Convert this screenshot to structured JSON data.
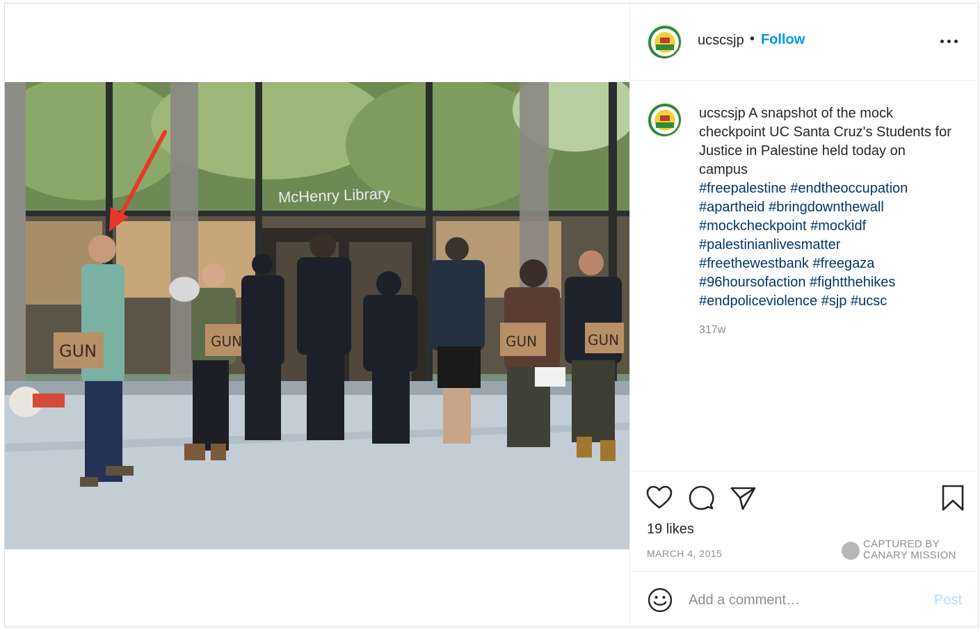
{
  "post": {
    "username": "ucscsjp",
    "separator": "•",
    "follow_label": "Follow",
    "more_icon": "more-horizontal-icon",
    "photo": {
      "building_sign": "McHenry Library",
      "sign_text": "GUN",
      "arrow_color": "#e8372b"
    },
    "caption": {
      "username": "ucscsjp",
      "text": "A snapshot of the mock checkpoint UC Santa Cruz's Students for Justice in Palestine held today on campus",
      "hashtags": [
        "#freepalestine",
        "#endtheoccupation",
        "#apartheid",
        "#bringdownthewall",
        "#mockcheckpoint",
        "#mockidf",
        "#palestinianlivesmatter",
        "#freethewestbank",
        "#freegaza",
        "#96hoursofaction",
        "#fightthehikes",
        "#endpoliceviolence",
        "#sjp",
        "#ucsc"
      ],
      "age": "317w"
    },
    "actions": {
      "like_icon": "heart-icon",
      "comment_icon": "comment-icon",
      "share_icon": "share-icon",
      "save_icon": "bookmark-icon"
    },
    "likes": "19 likes",
    "date": "MARCH 4, 2015",
    "watermark": {
      "line1": "CAPTURED BY",
      "line2": "CANARY MISSION"
    },
    "comment": {
      "placeholder": "Add a comment…",
      "post_label": "Post",
      "emoji_icon": "emoji-icon"
    },
    "colors": {
      "link_blue": "#0095f6",
      "hashtag": "#00376b",
      "muted": "#8e8e8e",
      "post_disabled": "#b2dffc"
    }
  }
}
